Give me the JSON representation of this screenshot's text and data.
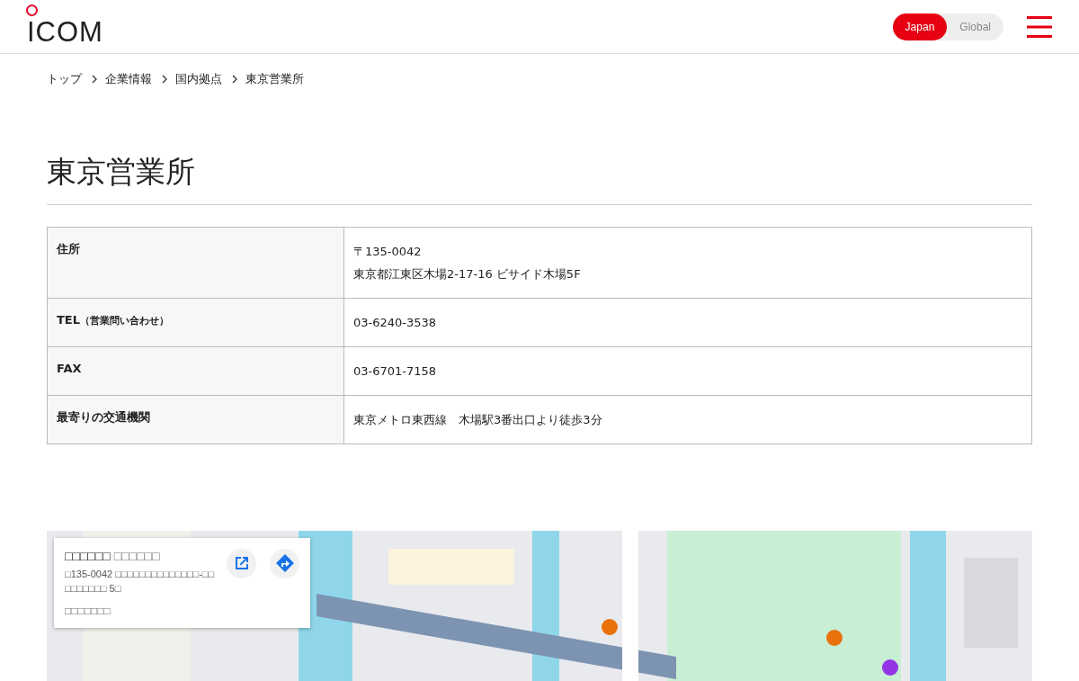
{
  "header": {
    "logo": "ICOM",
    "region_toggle": [
      {
        "label": "Japan",
        "selected": true
      },
      {
        "label": "Global",
        "selected": false
      }
    ]
  },
  "breadcrumb": [
    "トップ",
    "企業情報",
    "国内拠点",
    "東京営業所"
  ],
  "title": "東京営業所",
  "table": {
    "rows": [
      {
        "label": "住所",
        "values": [
          "〒135-0042",
          "東京都江東区木場2-17-16 ビサイド木場5F"
        ]
      },
      {
        "label": "TEL",
        "note": "（営業問い合わせ）",
        "values": [
          "03-6240-3538"
        ]
      },
      {
        "label": "FAX",
        "values": [
          "03-6701-7158"
        ]
      },
      {
        "label": "最寄りの交通機関",
        "values": [
          "東京メトロ東西線　木場駅3番出口より徒歩3分"
        ]
      }
    ]
  },
  "map": {
    "kind": "picture",
    "card": {
      "title": "□□□□□□",
      "subtitle": "□□□□□□",
      "address": "□135-0042 □□□□□□□□□□□□□□-□□ □□□□□□□ 5□",
      "link": "□□□□□□□"
    }
  }
}
